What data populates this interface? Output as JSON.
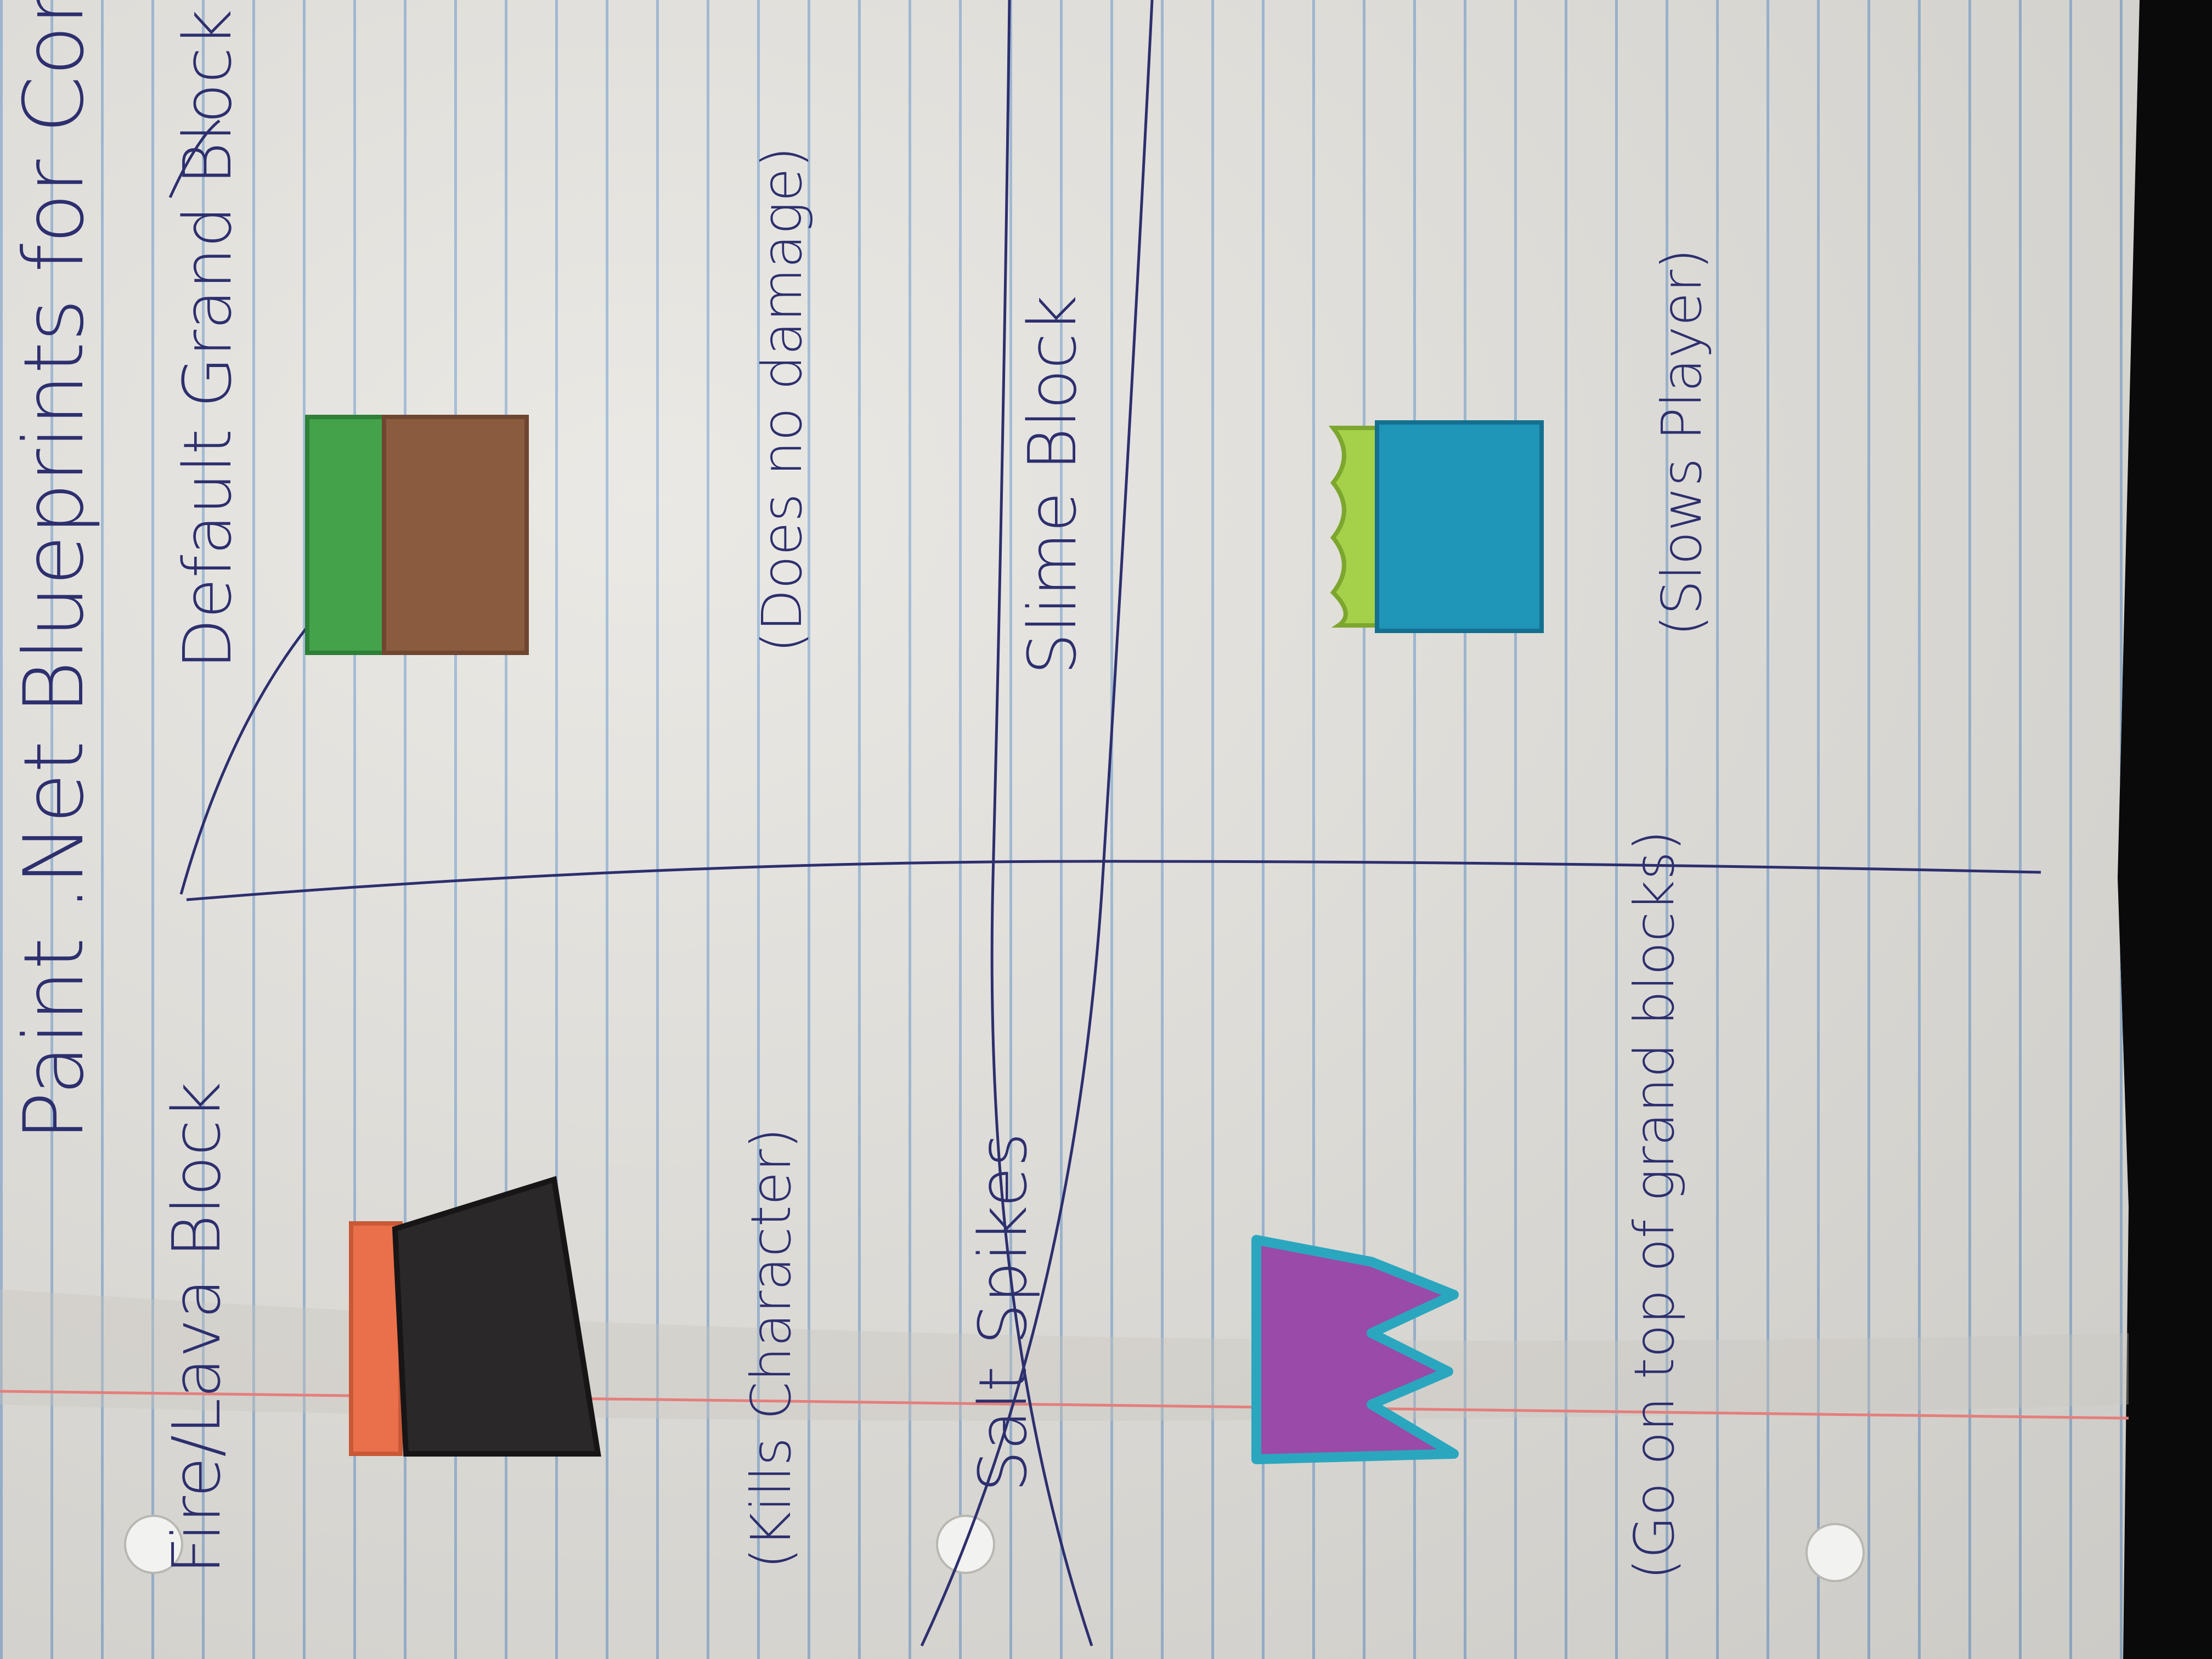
{
  "photo": {
    "subject": "notebook-page",
    "colors": {
      "paper": "#e8e6e1",
      "rule_line": "#8fb2d2",
      "margin_line": "#e47f7c",
      "ink": "#2d2f6e",
      "background": "#0b0a0b"
    }
  },
  "page": {
    "title": "Paint .Net Blueprints for Connor",
    "cells": [
      {
        "heading": "Default Grand Block",
        "note": "(Does no damage)",
        "drawing": {
          "name": "grass-dirt-block-drawing",
          "colors": [
            "#44a24a",
            "#8a5b3e"
          ]
        }
      },
      {
        "heading": "Fire/Lava Block",
        "note": "(Kills Character)",
        "drawing": {
          "name": "lava-block-drawing",
          "colors": [
            "#e9704a",
            "#2b2829"
          ]
        }
      },
      {
        "heading": "Slime Block",
        "note": "(Slows Player)",
        "drawing": {
          "name": "slime-block-drawing",
          "colors": [
            "#1f95b8",
            "#a5d14a"
          ]
        }
      },
      {
        "heading": "Salt Spikes",
        "note": "(Go on top of grand blocks)",
        "drawing": {
          "name": "salt-spikes-drawing",
          "colors": [
            "#9a4aa8",
            "#2aa7bf"
          ]
        }
      }
    ]
  }
}
